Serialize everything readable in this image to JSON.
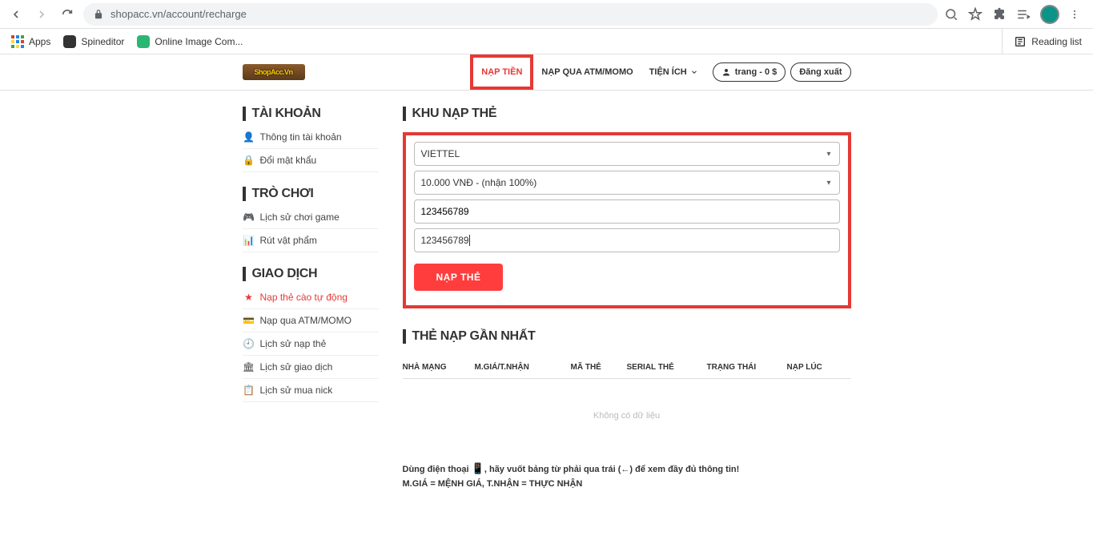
{
  "browser": {
    "url": "shopacc.vn/account/recharge",
    "bookmarks": {
      "apps": "Apps",
      "spineditor": "Spineditor",
      "onlineimg": "Online Image Com...",
      "readinglist": "Reading list"
    }
  },
  "header": {
    "logo": "ShopAcc.Vn",
    "menu": {
      "napTien": "NẠP TIỀN",
      "napAtm": "NẠP QUA ATM/MOMO",
      "tienIch": "TIỆN ÍCH"
    },
    "userBalance": "trang - 0 $",
    "logout": "Đăng xuất"
  },
  "sidebar": {
    "account": {
      "title": "TÀI KHOẢN",
      "info": "Thông tin tài khoản",
      "password": "Đổi mật khẩu"
    },
    "game": {
      "title": "TRÒ CHƠI",
      "history": "Lịch sử chơi game",
      "withdraw": "Rút vật phẩm"
    },
    "trans": {
      "title": "GIAO DỊCH",
      "topupAuto": "Nạp thẻ cào tự động",
      "topupAtm": "Nạp qua ATM/MOMO",
      "topupHist": "Lịch sử nạp thẻ",
      "transHist": "Lịch sử giao dịch",
      "buyHist": "Lịch sử mua nick"
    }
  },
  "form": {
    "title": "KHU NẠP THẺ",
    "telco": "VIETTEL",
    "amount": "10.000 VNĐ - (nhận 100%)",
    "pin": "123456789",
    "serial": "123456789",
    "submit": "NẠP THẺ"
  },
  "recent": {
    "title": "THẺ NẠP GẦN NHẤT",
    "cols": {
      "c1": "NHÀ MẠNG",
      "c2": "M.GIÁ/T.NHẬN",
      "c3": "MÃ THẺ",
      "c4": "SERIAL THẺ",
      "c5": "TRẠNG THÁI",
      "c6": "NẠP LÚC"
    },
    "nodata": "Không có dữ liệu",
    "hint1a": "Dùng điện thoại ",
    "hint1b": ", hãy vuốt bảng từ phải qua trái (←) để xem đầy đủ thông tin!",
    "hint2": "M.GIÁ = MỆNH GIÁ, T.NHẬN = THỰC NHẬN"
  }
}
